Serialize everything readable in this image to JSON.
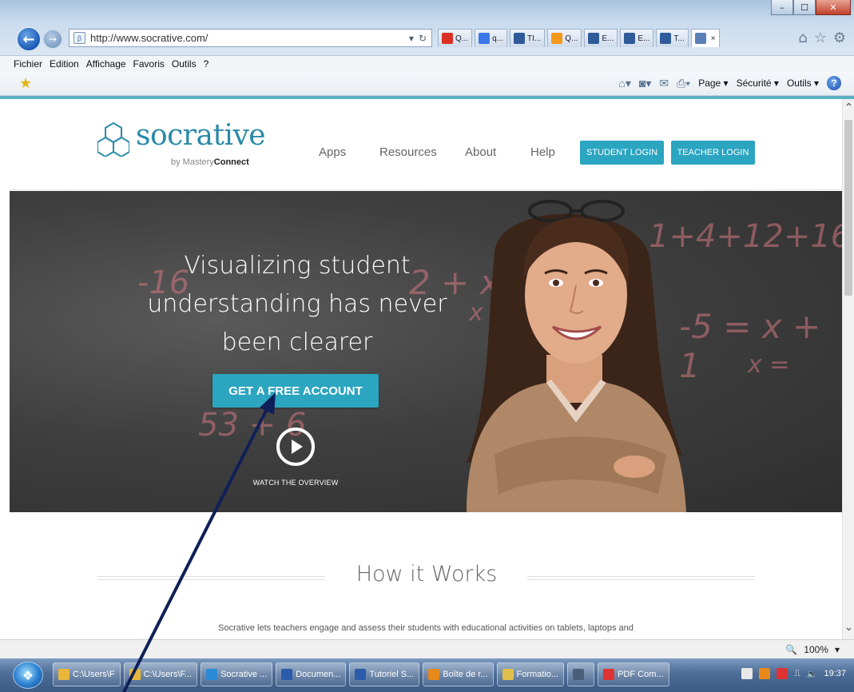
{
  "browser": {
    "address_url": "http://www.socrative.com/",
    "window_controls": [
      "–",
      "☐",
      "✕"
    ],
    "tabs": [
      {
        "label": "Q...",
        "icon_color": "#d93025"
      },
      {
        "label": "q...",
        "icon_color": "#3b78e7"
      },
      {
        "label": "TI...",
        "icon_color": "#2f5b9a"
      },
      {
        "label": "Q...",
        "icon_color": "#f39a1e"
      },
      {
        "label": "E...",
        "icon_color": "#2f5b9a"
      },
      {
        "label": "E...",
        "icon_color": "#2f5b9a"
      },
      {
        "label": "T...",
        "icon_color": "#2f5b9a"
      },
      {
        "label": "",
        "icon_color": "#5a7fb5"
      }
    ],
    "menu": [
      "Fichier",
      "Edition",
      "Affichage",
      "Favoris",
      "Outils",
      "?"
    ],
    "command_bar": {
      "page": "Page ▾",
      "security": "Sécurité ▾",
      "tools": "Outils ▾",
      "help": "?"
    },
    "zoom": "100%"
  },
  "site": {
    "logo_word": "socrative",
    "logo_sub_prefix": "by Mastery",
    "logo_sub_bold": "Connect",
    "nav": [
      "Apps",
      "Resources",
      "About",
      "Help"
    ],
    "student_login": "STUDENT LOGIN",
    "teacher_login": "TEACHER LOGIN",
    "accent": "#2ba5c0"
  },
  "hero": {
    "title_lines": [
      "Visualizing student",
      "understanding has never",
      "been clearer"
    ],
    "cta": "GET A FREE ACCOUNT",
    "watch": "WATCH THE OVERVIEW",
    "chalk": [
      "-16",
      "2 + x =",
      "1+4+12+16",
      "x =",
      "-5 = x + 1",
      "x =",
      "53 + 6"
    ]
  },
  "how": {
    "title": "How it Works",
    "desc": "Socrative lets teachers engage and assess their students with educational activities on tablets, laptops and"
  },
  "taskbar": {
    "items": [
      {
        "label": "C:\\Users\\F",
        "icon_color": "#e8b73a"
      },
      {
        "label": "C:\\Users\\F...",
        "icon_color": "#e8b73a"
      },
      {
        "label": "Socrative ...",
        "icon_color": "#2b8ad8"
      },
      {
        "label": "Documen...",
        "icon_color": "#2a5caa"
      },
      {
        "label": "Tutoriel S...",
        "icon_color": "#2a5caa"
      },
      {
        "label": "Boîte de r...",
        "icon_color": "#e8891a"
      },
      {
        "label": "Formatio...",
        "icon_color": "#e0c04a"
      },
      {
        "label": "",
        "icon_color": "#4a5e7a"
      },
      {
        "label": "PDF Com...",
        "icon_color": "#d33"
      }
    ],
    "clock": "19:37"
  }
}
